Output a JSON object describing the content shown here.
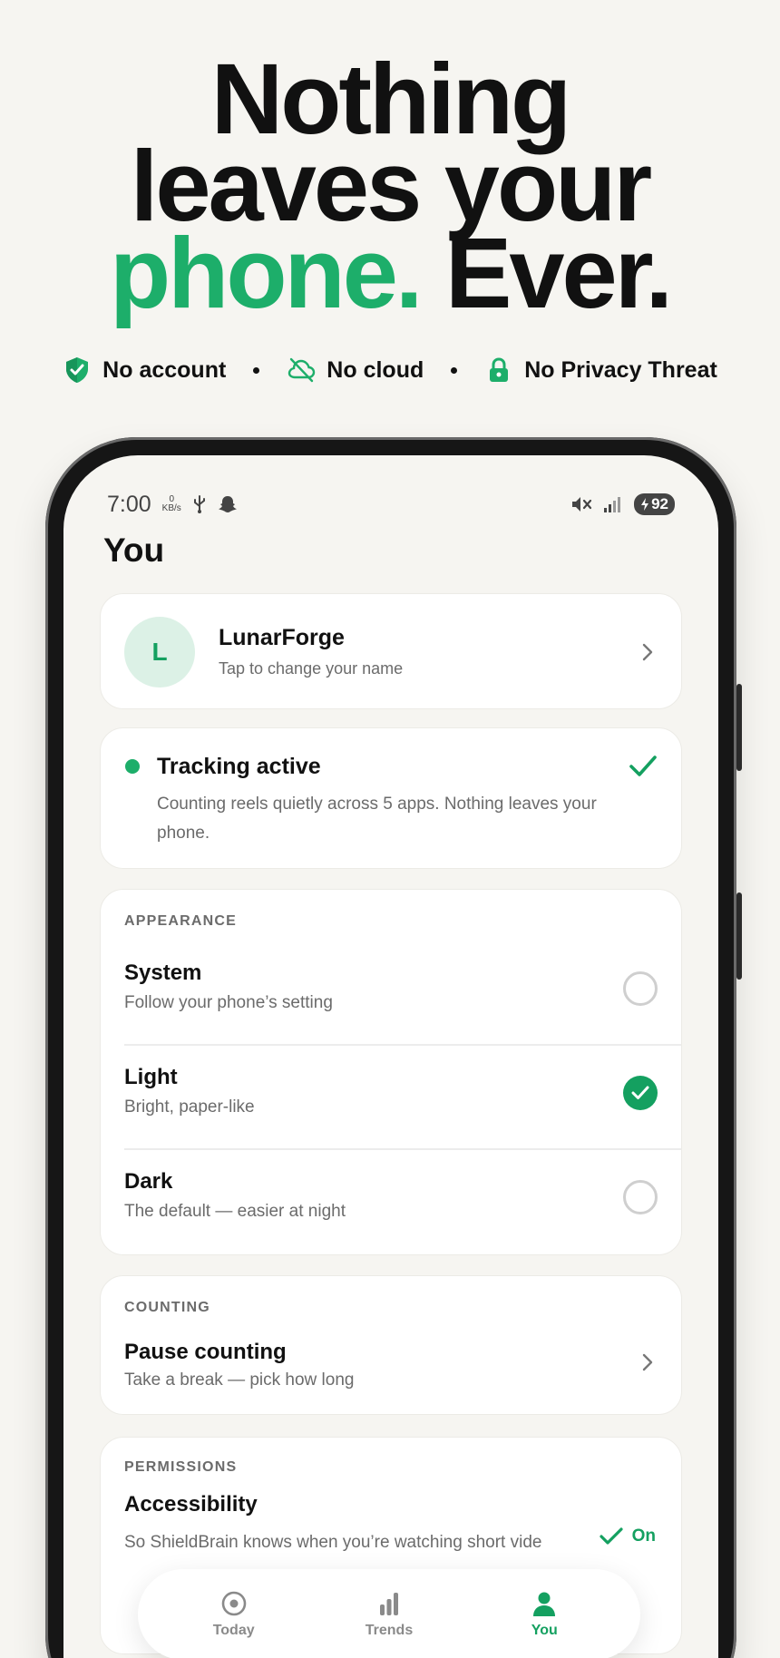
{
  "headline": {
    "line1": "Nothing",
    "line2": "leaves your",
    "line3_accent": "phone.",
    "line3_rest": "Ever."
  },
  "badges": [
    {
      "icon": "shield-icon",
      "label": "No account"
    },
    {
      "icon": "cloud-off-icon",
      "label": "No cloud"
    },
    {
      "icon": "lock-icon",
      "label": "No Privacy Threat"
    }
  ],
  "status_bar": {
    "time": "7:00",
    "speed_value": "0",
    "speed_unit": "KB/s",
    "battery": "92"
  },
  "page": {
    "title": "You"
  },
  "profile": {
    "avatar_letter": "L",
    "name": "LunarForge",
    "subtitle": "Tap to change your name"
  },
  "tracking": {
    "title": "Tracking active",
    "description": "Counting reels quietly across 5 apps. Nothing leaves your phone."
  },
  "appearance": {
    "label": "APPEARANCE",
    "options": [
      {
        "title": "System",
        "subtitle": "Follow your phone’s setting",
        "selected": false
      },
      {
        "title": "Light",
        "subtitle": "Bright, paper-like",
        "selected": true
      },
      {
        "title": "Dark",
        "subtitle": "The default — easier at night",
        "selected": false
      }
    ]
  },
  "counting": {
    "label": "COUNTING",
    "title": "Pause counting",
    "subtitle": "Take a break — pick how long"
  },
  "permissions": {
    "label": "PERMISSIONS",
    "title": "Accessibility",
    "subtitle": "So ShieldBrain knows when you’re watching short vide",
    "status": "On"
  },
  "nav": {
    "items": [
      {
        "label": "Today",
        "icon": "target-icon",
        "active": false
      },
      {
        "label": "Trends",
        "icon": "bar-chart-icon",
        "active": false
      },
      {
        "label": "You",
        "icon": "user-icon",
        "active": true
      }
    ]
  },
  "colors": {
    "accent": "#1dae6a",
    "background": "#f6f5f1",
    "card": "#ffffff",
    "muted_text": "#6b6b6b"
  }
}
